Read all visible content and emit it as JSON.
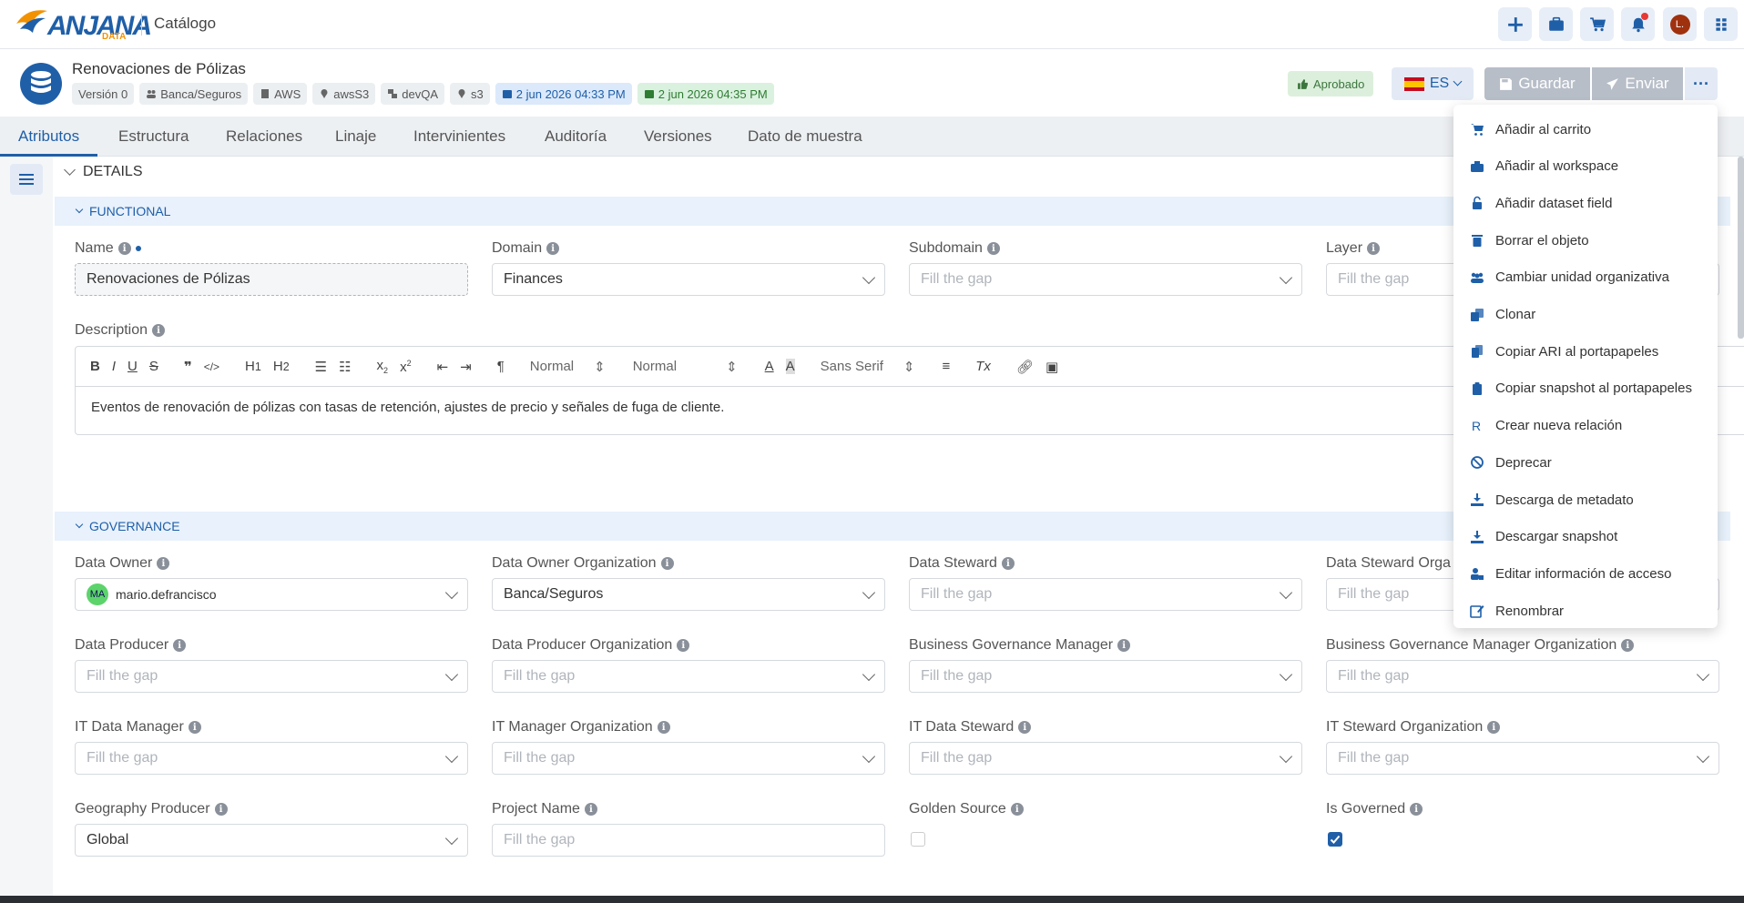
{
  "topbar": {
    "app_title": "Catálogo",
    "logo_text": "ANJANA",
    "logo_sub": "DATA",
    "avatar_initial": "L."
  },
  "header": {
    "title": "Renovaciones de Pólizas",
    "chips": {
      "version": "Versión 0",
      "org": "Banca/Seguros",
      "provider": "AWS",
      "location": "awsS3",
      "env": "devQA",
      "store": "s3",
      "created": "2 jun 2026 04:33 PM",
      "updated": "2 jun 2026 04:35 PM"
    },
    "status": "Aprobado",
    "lang": "ES",
    "save_label": "Guardar",
    "send_label": "Enviar"
  },
  "tabs": [
    "Atributos",
    "Estructura",
    "Relaciones",
    "Linaje",
    "Intervinientes",
    "Auditoría",
    "Versiones",
    "Dato de muestra"
  ],
  "details": {
    "title": "DETAILS",
    "functional": "FUNCTIONAL",
    "governance": "GOVERNANCE",
    "name_label": "Name",
    "name_value": "Renovaciones de Pólizas",
    "domain_label": "Domain",
    "domain_value": "Finances",
    "subdomain_label": "Subdomain",
    "layer_label": "Layer",
    "placeholder": "Fill the gap",
    "description_label": "Description",
    "toolbar": {
      "header1": "Normal",
      "header2": "Normal",
      "font": "Sans Serif"
    },
    "description_value": "Eventos de renovación de pólizas con tasas de retención, ajustes de precio y señales de fuga de cliente.",
    "data_owner_label": "Data Owner",
    "data_owner_value": "mario.defrancisco",
    "data_owner_initials": "MA",
    "data_owner_org_label": "Data Owner Organization",
    "data_owner_org_value": "Banca/Seguros",
    "data_steward_label": "Data Steward",
    "data_steward_org_label": "Data Steward Orga",
    "data_producer_label": "Data Producer",
    "data_producer_org_label": "Data Producer Organization",
    "bgm_label": "Business Governance Manager",
    "bgm_org_label": "Business Governance Manager Organization",
    "it_data_manager_label": "IT Data Manager",
    "it_manager_org_label": "IT Manager Organization",
    "it_data_steward_label": "IT Data Steward",
    "it_steward_org_label": "IT Steward Organization",
    "geography_label": "Geography Producer",
    "geography_value": "Global",
    "project_label": "Project Name",
    "golden_label": "Golden Source",
    "governed_label": "Is Governed",
    "golden_checked": false,
    "governed_checked": true
  },
  "menu": {
    "items": [
      {
        "label": "Añadir al carrito",
        "icon": "cart-icon"
      },
      {
        "label": "Añadir al workspace",
        "icon": "briefcase-icon"
      },
      {
        "label": "Añadir dataset field",
        "icon": "unlock-icon"
      },
      {
        "label": "Borrar el objeto",
        "icon": "trash-icon"
      },
      {
        "label": "Cambiar unidad organizativa",
        "icon": "users-icon"
      },
      {
        "label": "Clonar",
        "icon": "clone-icon"
      },
      {
        "label": "Copiar ARI al portapapeles",
        "icon": "copy-icon"
      },
      {
        "label": "Copiar snapshot al portapapeles",
        "icon": "clipboard-icon"
      },
      {
        "label": "Crear nueva relación",
        "icon": "relation-icon"
      },
      {
        "label": "Deprecar",
        "icon": "ban-icon"
      },
      {
        "label": "Descarga de metadato",
        "icon": "download-icon"
      },
      {
        "label": "Descargar snapshot",
        "icon": "download-icon"
      },
      {
        "label": "Editar información de acceso",
        "icon": "user-lock-icon"
      },
      {
        "label": "Renombrar",
        "icon": "edit-icon"
      }
    ]
  },
  "colors": {
    "accent": "#1f5fa8",
    "approved_bg": "#dcefdc",
    "menu_icon": "#1f5fa8"
  }
}
